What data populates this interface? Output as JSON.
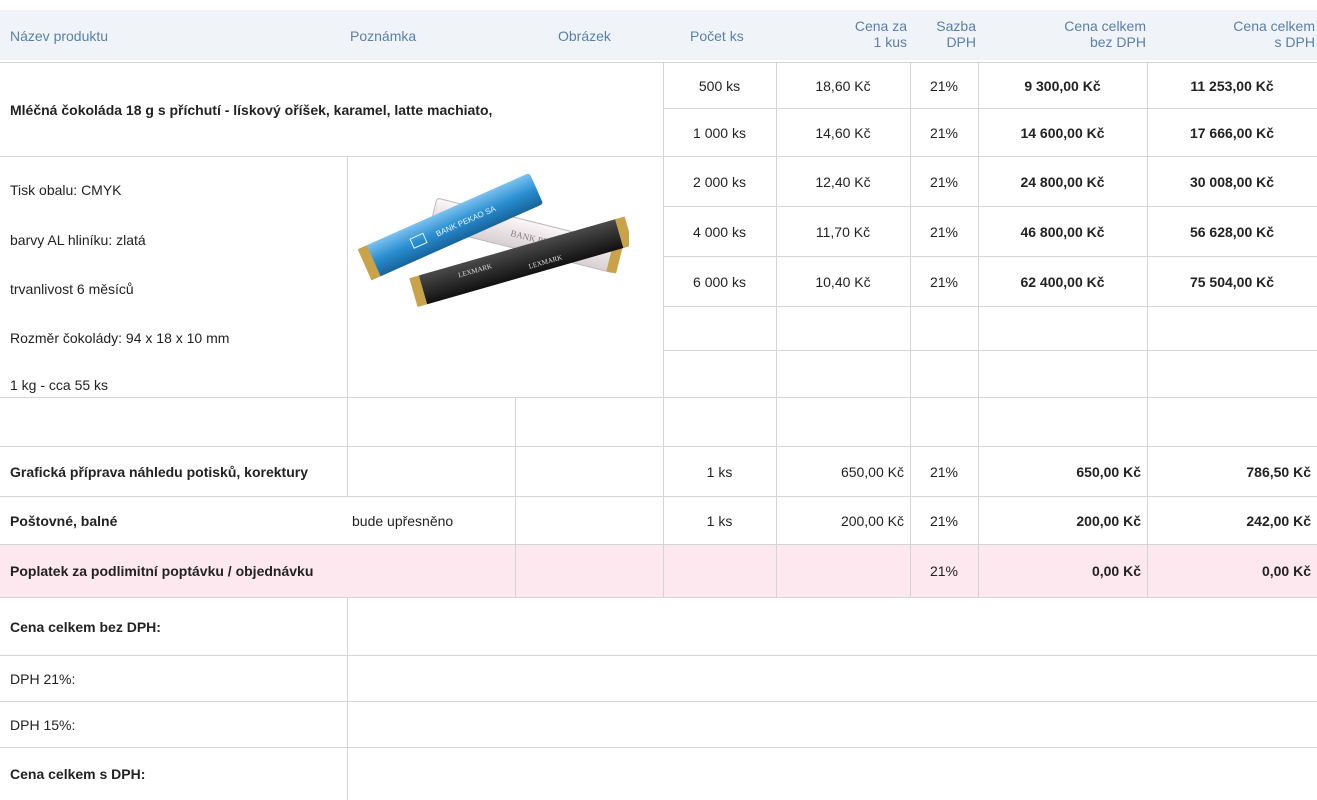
{
  "header": {
    "col_product": "Název produktu",
    "col_note": "Poznámka",
    "col_image": "Obrázek",
    "col_qty": "Počet ks",
    "col_price_l1": "Cena za",
    "col_price_l2": "1 kus",
    "col_vat_l1": "Sazba",
    "col_vat_l2": "DPH",
    "col_total_net_l1": "Cena celkem",
    "col_total_net_l2": "bez DPH",
    "col_total_gross_l1": "Cena celkem",
    "col_total_gross_l2": "s DPH"
  },
  "product": {
    "name": "Mléčná čokoláda 18 g s příchutí - lískový oříšek, karamel, latte machiato,",
    "image": "chocolate-bars-photo",
    "specs": [
      "Tisk obalu: CMYK",
      "barvy AL hliníku: zlatá",
      "trvanlivost  6 měsíců",
      "Rozměr čokolády: 94 x 18 x 10 mm",
      "1 kg - cca 55 ks"
    ],
    "wrapper_texts": [
      "BANK PEKAO SA",
      "BANK PEKAO SA",
      "LEXMARK"
    ],
    "price_rows": [
      {
        "qty": "500 ks",
        "unit": "18,60 Kč",
        "vat": "21%",
        "net": "9 300,00 Kč",
        "gross": "11 253,00 Kč"
      },
      {
        "qty": "1 000 ks",
        "unit": "14,60 Kč",
        "vat": "21%",
        "net": "14 600,00 Kč",
        "gross": "17 666,00 Kč"
      },
      {
        "qty": "2 000 ks",
        "unit": "12,40 Kč",
        "vat": "21%",
        "net": "24 800,00 Kč",
        "gross": "30 008,00 Kč"
      },
      {
        "qty": "4 000 ks",
        "unit": "11,70 Kč",
        "vat": "21%",
        "net": "46 800,00 Kč",
        "gross": "56 628,00 Kč"
      },
      {
        "qty": "6 000 ks",
        "unit": "10,40 Kč",
        "vat": "21%",
        "net": "62 400,00 Kč",
        "gross": "75 504,00 Kč"
      }
    ]
  },
  "extras": [
    {
      "name": "Grafická příprava náhledu potisků, korektury",
      "note": "",
      "qty": "1 ks",
      "unit": "650,00 Kč",
      "vat": "21%",
      "net": "650,00 Kč",
      "gross": "786,50 Kč"
    },
    {
      "name": "Poštovné, balné",
      "note": "bude upřesněno",
      "qty": "1 ks",
      "unit": "200,00 Kč",
      "vat": "21%",
      "net": "200,00 Kč",
      "gross": "242,00 Kč"
    }
  ],
  "surcharge": {
    "name": "Poplatek za podlimitní poptávku / objednávku",
    "vat": "21%",
    "net": "0,00 Kč",
    "gross": "0,00 Kč"
  },
  "summary": {
    "total_net": "Cena celkem bez DPH:",
    "vat21": "DPH 21%:",
    "vat15": "DPH 15%:",
    "total_gross": "Cena celkem s DPH:"
  },
  "colors": {
    "header_bg": "#f0f4f9",
    "header_text": "#5b7fa8",
    "surcharge_bg": "#fce8ee",
    "grid": "#d4d4d4"
  }
}
